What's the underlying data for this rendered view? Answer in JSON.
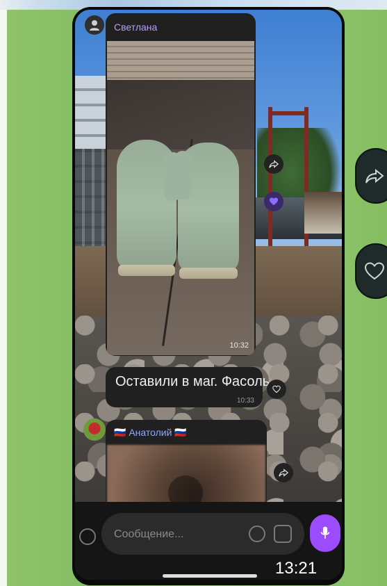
{
  "chat": {
    "messages": [
      {
        "sender": "Светлана",
        "photo_time": "10:32"
      },
      {
        "text": "Оставили в маг. Фасоль",
        "time": "10:33"
      },
      {
        "sender": "🇷🇺 Анатолий 🇷🇺"
      }
    ]
  },
  "composer": {
    "placeholder": "Сообщение..."
  },
  "status": {
    "clock": "13:21"
  },
  "icons": {
    "share": "share-icon",
    "heart": "heart-icon",
    "mic": "microphone-icon",
    "emoji": "emoji-icon",
    "sticker": "sticker-icon",
    "attach": "attach-icon"
  },
  "colors": {
    "accent": "#9b4cff",
    "sender1": "#b59bff",
    "sender2": "#8fa8ff",
    "background": "#8cc26a"
  }
}
